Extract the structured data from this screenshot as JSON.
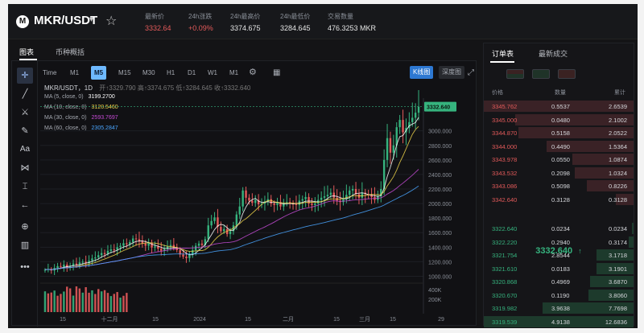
{
  "header": {
    "logo_glyph": "M",
    "pair": "MKR/USDT",
    "stats": [
      {
        "label": "最新价",
        "value": "3332.64",
        "color": "red"
      },
      {
        "label": "24h涨跌",
        "value": "+0.09%",
        "color": "red"
      },
      {
        "label": "24h最高价",
        "value": "3374.675",
        "color": "normal"
      },
      {
        "label": "24h最低价",
        "value": "3284.645",
        "color": "normal"
      },
      {
        "label": "交易数量",
        "value": "476.3253 MKR",
        "color": "normal"
      }
    ]
  },
  "chart_tabs": {
    "chart": "图表",
    "info": "币种概括"
  },
  "intervals": [
    "Time",
    "M1",
    "M5",
    "M15",
    "M30",
    "H1",
    "D1",
    "W1",
    "M1"
  ],
  "interval_active_index": 2,
  "view_buttons": {
    "kline": "K线图",
    "depth": "深度图"
  },
  "legend": {
    "header": "MKR/USDT，1D",
    "ohlc": "开↑3329.790 高↑3374.675 低↑3284.645 收↑3332.640",
    "ma": [
      {
        "name": "MA (5, close, 0)",
        "value": "3199.2700",
        "color": "#ffffff"
      },
      {
        "name": "MA (10, close, 0)",
        "value": "3120.5460",
        "color": "#f0d54a"
      },
      {
        "name": "MA (30, close, 0)",
        "value": "2593.7697",
        "color": "#c64bd6"
      },
      {
        "name": "MA (60, close, 0)",
        "value": "2305.2847",
        "color": "#4aa6ff"
      }
    ]
  },
  "chart_data": {
    "type": "candlestick",
    "y_ticks": [
      "3000.000",
      "2800.000",
      "2600.000",
      "2400.000",
      "2200.000",
      "2000.000",
      "1800.000",
      "1600.000",
      "1400.000",
      "1200.000",
      "1000.000"
    ],
    "ylim": [
      950,
      3450
    ],
    "volume_ticks": [
      "400K",
      "200K"
    ],
    "x_ticks": [
      "15",
      "十二月",
      "15",
      "2024",
      "15",
      "二月",
      "15",
      "三月",
      "15",
      "29"
    ],
    "last_price_tag": "3332.640",
    "close_values": [
      1090,
      1100,
      1080,
      1115,
      1140,
      1130,
      1160,
      1120,
      1145,
      1175,
      1160,
      1190,
      1200,
      1180,
      1215,
      1245,
      1260,
      1290,
      1320,
      1305,
      1350,
      1370,
      1365,
      1400,
      1420,
      1455,
      1440,
      1470,
      1520,
      1510,
      1480,
      1450,
      1420,
      1460,
      1395,
      1410,
      1380,
      1350,
      1375,
      1410,
      1430,
      1390,
      1360,
      1300,
      1270,
      1250,
      1300,
      1360,
      1420,
      1450,
      1430,
      1510,
      1700,
      1760,
      1810,
      1680,
      1620,
      1650,
      1580,
      1620,
      1700,
      1850,
      1960,
      2180,
      2080,
      2040,
      2010,
      2050,
      1990,
      2000,
      2030,
      2060,
      2000,
      1980,
      2020,
      1960,
      2010,
      2020,
      2000,
      1995,
      1980,
      2040,
      2060,
      2090,
      2000,
      1980,
      2000,
      2050,
      2080,
      2100,
      2120,
      2150,
      2080,
      2040,
      2020,
      2060,
      2120,
      2180,
      2200,
      2130,
      2080,
      2150,
      2130,
      2120,
      2090,
      2050,
      2100,
      2200,
      2600,
      2900,
      2700,
      2800,
      3050,
      3150,
      2980,
      3040,
      3120,
      3180,
      3250,
      3332
    ]
  },
  "orderbook": {
    "tabs": {
      "book": "订单表",
      "trades": "最新成交"
    },
    "columns": {
      "price": "价格",
      "qty": "数量",
      "total": "累计"
    },
    "asks": [
      {
        "price": "3345.762",
        "qty": "0.5537",
        "total": "2.6539",
        "depth": 1.0
      },
      {
        "price": "3345.000",
        "qty": "0.0480",
        "total": "2.1002",
        "depth": 0.79
      },
      {
        "price": "3344.870",
        "qty": "0.5158",
        "total": "2.0522",
        "depth": 0.77
      },
      {
        "price": "3344.000",
        "qty": "0.4490",
        "total": "1.5364",
        "depth": 0.58
      },
      {
        "price": "3343.978",
        "qty": "0.0550",
        "total": "1.0874",
        "depth": 0.41
      },
      {
        "price": "3343.532",
        "qty": "0.2098",
        "total": "1.0324",
        "depth": 0.39
      },
      {
        "price": "3343.086",
        "qty": "0.5098",
        "total": "0.8226",
        "depth": 0.31
      },
      {
        "price": "3342.640",
        "qty": "0.3128",
        "total": "0.3128",
        "depth": 0.12
      }
    ],
    "mid_price": "3332.640",
    "mid_arrow": "↑",
    "bids": [
      {
        "price": "3322.640",
        "qty": "0.0234",
        "total": "0.0234",
        "depth": 0.01
      },
      {
        "price": "3322.220",
        "qty": "0.2940",
        "total": "0.3174",
        "depth": 0.03
      },
      {
        "price": "3321.754",
        "qty": "2.8544",
        "total": "3.1718",
        "depth": 0.25
      },
      {
        "price": "3321.610",
        "qty": "0.0183",
        "total": "3.1901",
        "depth": 0.25
      },
      {
        "price": "3320.868",
        "qty": "0.4969",
        "total": "3.6870",
        "depth": 0.29
      },
      {
        "price": "3320.670",
        "qty": "0.1190",
        "total": "3.8060",
        "depth": 0.3
      },
      {
        "price": "3319.982",
        "qty": "3.9638",
        "total": "7.7698",
        "depth": 0.61
      },
      {
        "price": "3319.539",
        "qty": "4.9138",
        "total": "12.6836",
        "depth": 1.0
      }
    ]
  }
}
